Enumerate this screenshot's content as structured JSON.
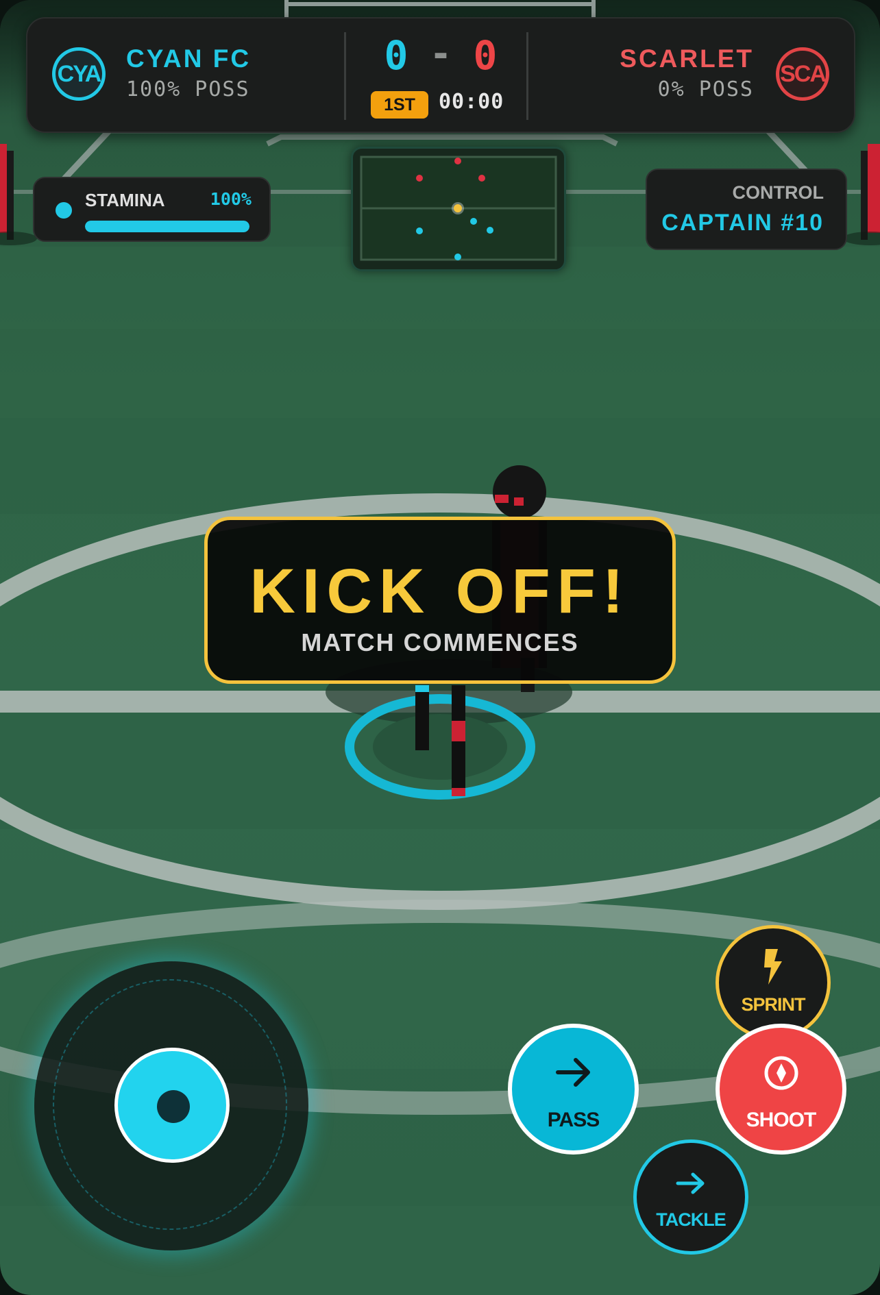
{
  "scoreboard": {
    "home": {
      "badge": "CYA",
      "name": "CYAN FC",
      "possession": "100% POSS",
      "score": "0",
      "color": "#22c9e6"
    },
    "away": {
      "badge": "SCA",
      "name": "SCARLET",
      "possession": "0% POSS",
      "score": "0",
      "color": "#ee4547"
    },
    "separator": "-",
    "period": "1ST",
    "clock": "00:00"
  },
  "stamina": {
    "label": "STAMINA",
    "value_text": "100%",
    "level": 1.0
  },
  "control": {
    "label": "CONTROL",
    "player": "CAPTAIN #10"
  },
  "banner": {
    "title": "KICK OFF!",
    "subtitle": "MATCH COMMENCES"
  },
  "minimap": {
    "teams": [
      "cyan",
      "scarlet"
    ],
    "ball": "ball-marker"
  },
  "actions": {
    "sprint": {
      "label": "SPRINT",
      "icon": "lightning-icon"
    },
    "pass": {
      "label": "PASS",
      "icon": "arrow-right-icon"
    },
    "shoot": {
      "label": "SHOOT",
      "icon": "target-icon"
    },
    "tackle": {
      "label": "TACKLE",
      "icon": "arrow-right-icon"
    }
  },
  "colors": {
    "accent_home": "#22c9e6",
    "accent_away": "#ee4547",
    "highlight": "#f4c33d",
    "pitch": "#2f6446"
  }
}
